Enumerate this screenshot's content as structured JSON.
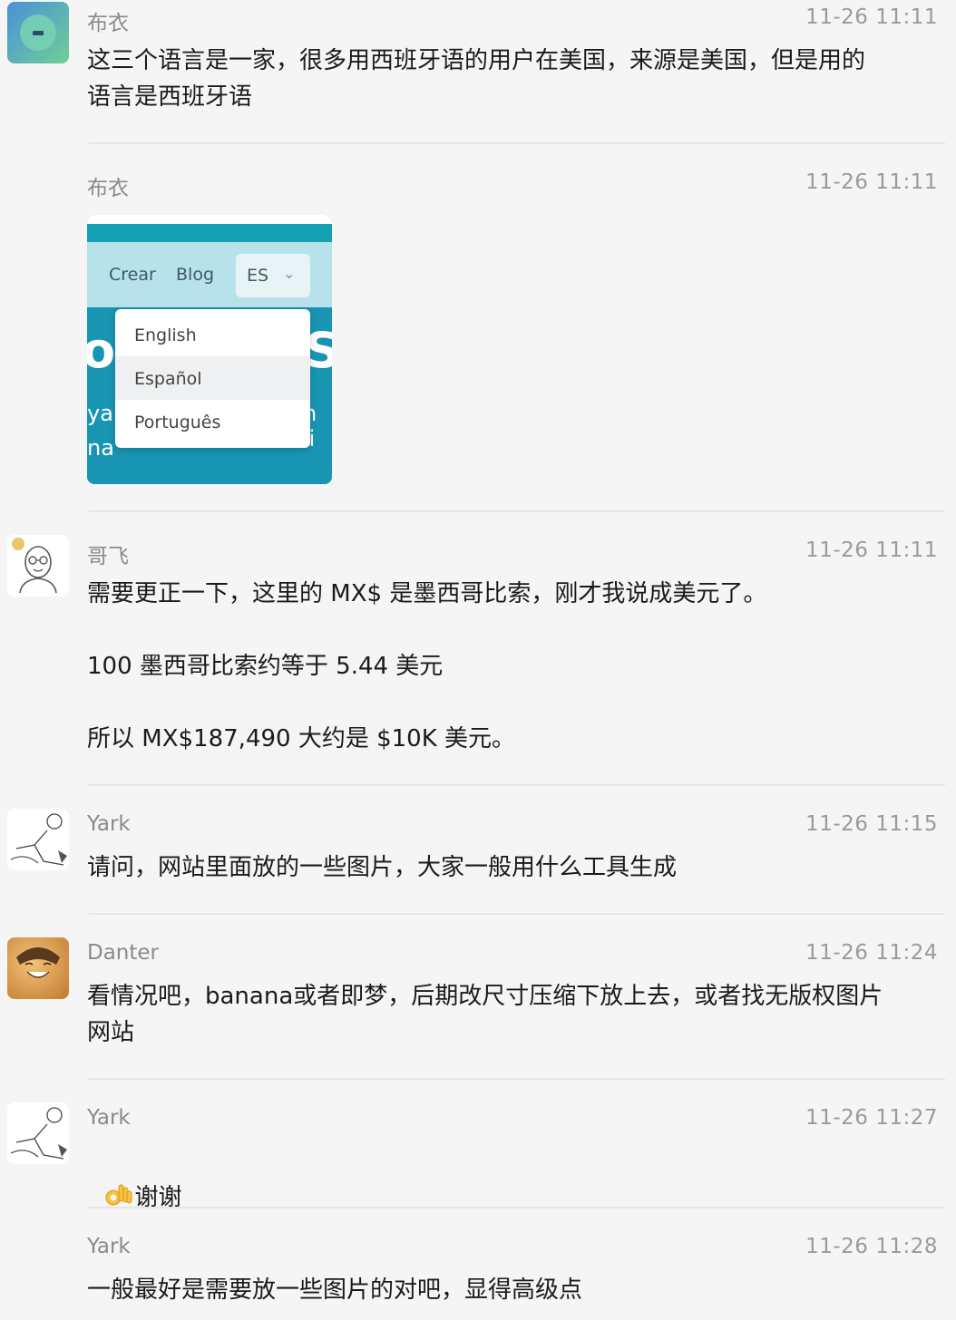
{
  "messages": [
    {
      "name": "布衣",
      "time": "11-26 11:11",
      "text": "这三个语言是一家，很多用西班牙语的用户在美国，来源是美国，但是用的\n语言是西班牙语"
    },
    {
      "name": "布衣",
      "time": "11-26 11:11",
      "image": {
        "nav": [
          "Crear",
          "Blog"
        ],
        "lang_selected": "ES",
        "options": [
          "English",
          "Español",
          "Português"
        ],
        "active_option": "Español",
        "bg_fragments": [
          "o",
          "SI",
          "ya",
          "n li",
          "na"
        ]
      }
    },
    {
      "name": "哥飞",
      "time": "11-26 11:11",
      "text": "需要更正一下，这里的 MX$ 是墨西哥比索，刚才我说成美元了。\n\n100 墨西哥比索约等于 5.44 美元\n\n所以 MX$187,490 大约是 $10K 美元。"
    },
    {
      "name": "Yark",
      "time": "11-26 11:15",
      "text": "请问，网站里面放的一些图片，大家一般用什么工具生成"
    },
    {
      "name": "Danter",
      "time": "11-26 11:24",
      "text": "看情况吧，banana或者即梦，后期改尺寸压缩下放上去，或者找无版权图片\n网站"
    },
    {
      "name": "Yark",
      "time": "11-26 11:27",
      "text": "谢谢",
      "emoji": "ok-hand-emoji"
    },
    {
      "name": "Yark",
      "time": "11-26 11:28",
      "text": "一般最好是需要放一些图片的对吧，显得高级点"
    }
  ],
  "colors": {
    "background": "#f5f5f5",
    "name": "#8a8a8a",
    "text": "#1a1a1a",
    "accent_teal": "#15a0b3"
  }
}
